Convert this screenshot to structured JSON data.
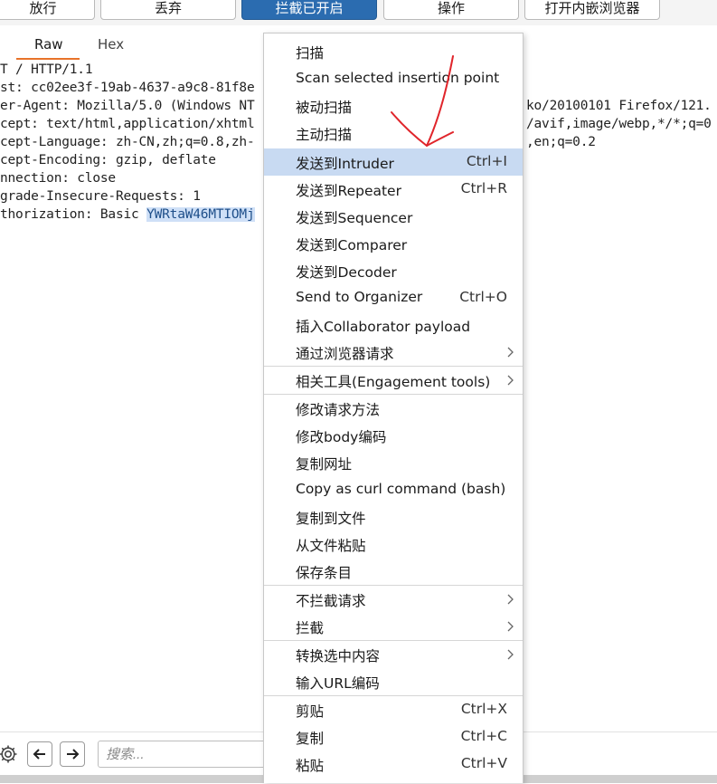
{
  "toolbar": {
    "forward_label": "放行",
    "drop_label": "丢弃",
    "intercept_label": "拦截已开启",
    "action_label": "操作",
    "browser_label": "打开内嵌浏览器"
  },
  "tabs": {
    "raw": "Raw",
    "hex": "Hex"
  },
  "request": {
    "lines": [
      "T / HTTP/1.1",
      "st: cc02ee3f-19ab-4637-a9c8-81f8e",
      "er-Agent: Mozilla/5.0 (Windows NT",
      "cept: text/html,application/xhtml",
      "cept-Language: zh-CN,zh;q=0.8,zh-",
      "cept-Encoding: gzip, deflate",
      "nnection: close",
      "grade-Insecure-Requests: 1",
      "thorization: Basic "
    ],
    "auth_selected": "YWRtaW46MTIOMj",
    "right_fragments": [
      "ko/20100101 Firefox/121.",
      "/avif,image/webp,*/*;q=0",
      ",en;q=0.2"
    ]
  },
  "search": {
    "placeholder": "搜索..."
  },
  "menu": {
    "scan": "扫描",
    "scan_insertion": "Scan selected insertion point",
    "passive_scan": "被动扫描",
    "active_scan": "主动扫描",
    "send_intruder": "发送到Intruder",
    "send_intruder_sc": "Ctrl+I",
    "send_repeater": "发送到Repeater",
    "send_repeater_sc": "Ctrl+R",
    "send_sequencer": "发送到Sequencer",
    "send_comparer": "发送到Comparer",
    "send_decoder": "发送到Decoder",
    "send_organizer": "Send to Organizer",
    "send_organizer_sc": "Ctrl+O",
    "insert_collab": "插入Collaborator payload",
    "browser_request": "通过浏览器请求",
    "engagement_tools": "相关工具(Engagement tools)",
    "change_method": "修改请求方法",
    "change_body_encoding": "修改body编码",
    "copy_url": "复制网址",
    "copy_curl": "Copy as curl command (bash)",
    "copy_to_file": "复制到文件",
    "paste_from_file": "从文件粘贴",
    "save_item": "保存条目",
    "dont_intercept": "不拦截请求",
    "intercept": "拦截",
    "convert_selection": "转换选中内容",
    "url_encode_typing": "输入URL编码",
    "cut": "剪贴",
    "cut_sc": "Ctrl+X",
    "copy": "复制",
    "copy_sc": "Ctrl+C",
    "paste": "粘贴",
    "paste_sc": "Ctrl+V"
  },
  "colors": {
    "accent": "#2b6cb0",
    "tab_underline": "#e8732a",
    "menu_highlight": "#c8daf2",
    "annotation_arrow": "#e0252b"
  }
}
